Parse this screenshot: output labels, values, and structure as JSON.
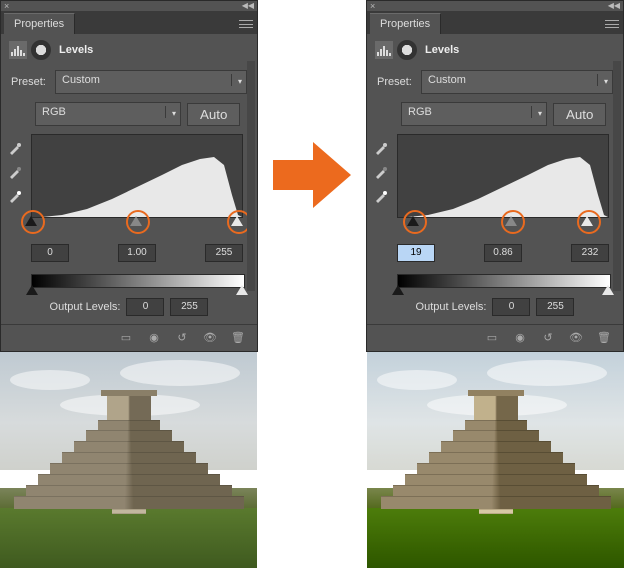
{
  "panel_title": "Properties",
  "adjustment": "Levels",
  "preset_label": "Preset:",
  "preset_value": "Custom",
  "channel_value": "RGB",
  "auto_label": "Auto",
  "output_label": "Output Levels:",
  "left": {
    "shadows": "0",
    "midtones": "1.00",
    "highlights": "255",
    "output_lo": "0",
    "output_hi": "255"
  },
  "right": {
    "shadows": "19",
    "midtones": "0.86",
    "highlights": "232",
    "output_lo": "0",
    "output_hi": "255"
  },
  "chart_data": [
    {
      "type": "area",
      "title": "Histogram (before)",
      "xlabel": "",
      "ylabel": "",
      "x_range": [
        0,
        255
      ],
      "series": [
        {
          "name": "RGB",
          "values": [
            0,
            0,
            1,
            2,
            3,
            6,
            10,
            16,
            24,
            34,
            44,
            52,
            58,
            62,
            64,
            66,
            68,
            70,
            72,
            74,
            76,
            78,
            78,
            76,
            70,
            60,
            40,
            16,
            4,
            0,
            0,
            0
          ]
        }
      ],
      "input_sliders": {
        "shadows": 0,
        "midtones": 1.0,
        "highlights": 255
      },
      "output_levels": {
        "lo": 0,
        "hi": 255
      }
    },
    {
      "type": "area",
      "title": "Histogram (after)",
      "xlabel": "",
      "ylabel": "",
      "x_range": [
        0,
        255
      ],
      "series": [
        {
          "name": "RGB",
          "values": [
            0,
            0,
            1,
            2,
            3,
            6,
            10,
            16,
            24,
            34,
            44,
            52,
            58,
            62,
            64,
            66,
            68,
            70,
            72,
            74,
            76,
            78,
            78,
            76,
            70,
            60,
            40,
            16,
            4,
            0,
            0,
            0
          ]
        }
      ],
      "input_sliders": {
        "shadows": 19,
        "midtones": 0.86,
        "highlights": 232
      },
      "output_levels": {
        "lo": 0,
        "hi": 255
      }
    }
  ]
}
